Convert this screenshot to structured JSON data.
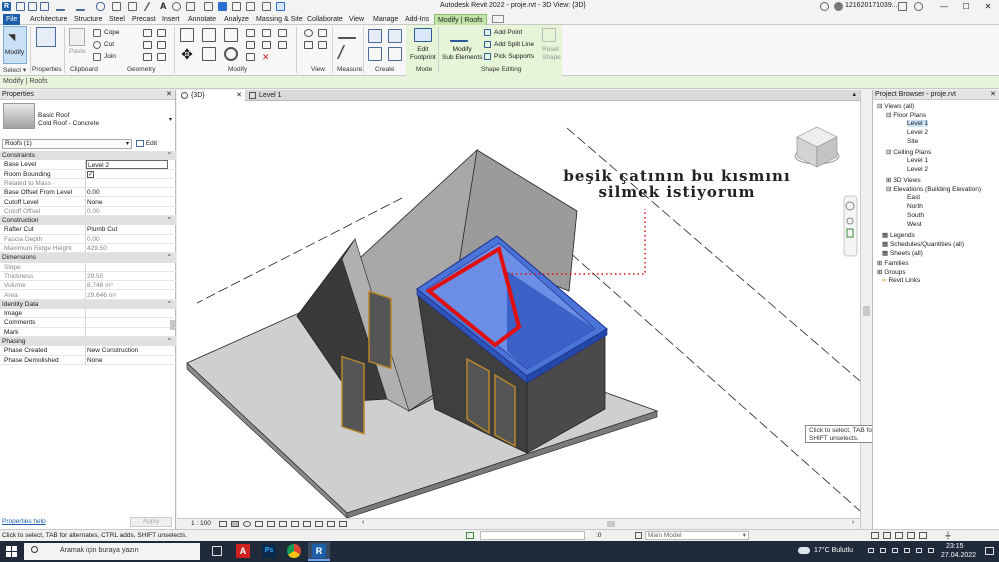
{
  "titlebar": {
    "app_title": "Autodesk Revit 2022 - proje.rvt - 3D View: {3D}",
    "user": "121620171039...",
    "minimize": "—",
    "maximize": "☐",
    "close": "✕"
  },
  "tabs": [
    "File",
    "Architecture",
    "Structure",
    "Steel",
    "Precast",
    "Insert",
    "Annotate",
    "Analyze",
    "Massing & Site",
    "Collaborate",
    "View",
    "Manage",
    "Add-Ins",
    "Modify | Roofs"
  ],
  "ribbon": {
    "modify": "Modify",
    "properties": "Properties",
    "paste": "Paste",
    "cope": "Cope",
    "cut": "Cut",
    "join": "Join",
    "edit_footprint": "Edit\nFootprint",
    "modify_sub": "Modify\nSub Elements",
    "add_point": "Add Point",
    "add_split_line": "Add Split Line",
    "pick_supports": "Pick Supports",
    "reset_shape": "Reset\nShape",
    "panels": {
      "select": "Select ▾",
      "properties": "Properties",
      "clipboard": "Clipboard",
      "geometry": "Geometry",
      "modify": "Modify",
      "view": "View",
      "measure": "Measure",
      "create": "Create",
      "mode": "Mode",
      "shape_editing": "Shape Editing"
    }
  },
  "options_bar": "Modify | Roofs",
  "properties": {
    "header": "Properties",
    "type_family": "Basic Roof",
    "type_name": "Cold Roof - Concrete",
    "selector": "Roofs (1)",
    "edit_type": "Edit Type",
    "groups": {
      "constraints": "Constraints",
      "construction": "Construction",
      "dimensions": "Dimensions",
      "identity": "Identity Data",
      "phasing": "Phasing"
    },
    "rows": {
      "base_level": [
        "Base Level",
        "Level 2"
      ],
      "room_bounding": [
        "Room Bounding",
        ""
      ],
      "related_mass": [
        "Related to Mass",
        ""
      ],
      "base_offset": [
        "Base Offset From Level",
        "0.00"
      ],
      "cutoff_level": [
        "Cutoff Level",
        "None"
      ],
      "cutoff_offset": [
        "Cutoff Offset",
        "0.00"
      ],
      "rafter_cut": [
        "Rafter Cut",
        "Plumb Cut"
      ],
      "fascia_depth": [
        "Fascia Depth",
        "0.00"
      ],
      "max_ridge": [
        "Maximum Ridge Height",
        "429.50"
      ],
      "slope": [
        "Slope",
        ""
      ],
      "thickness": [
        "Thickness",
        "29.50"
      ],
      "volume": [
        "Volume",
        "8.746 m³"
      ],
      "area": [
        "Area",
        "29.646 m²"
      ],
      "image": [
        "Image",
        ""
      ],
      "comments": [
        "Comments",
        ""
      ],
      "mark": [
        "Mark",
        ""
      ],
      "phase_created": [
        "Phase Created",
        "New Construction"
      ],
      "phase_demolished": [
        "Phase Demolished",
        "None"
      ]
    },
    "help_link": "Properties help",
    "apply": "Apply"
  },
  "view_tabs": [
    "{3D}",
    "Level 1"
  ],
  "viewport": {
    "annotation_line1": "beşik çatının bu kısmını",
    "annotation_line2": "silmek istiyorum",
    "scale": "1 : 100"
  },
  "tooltip": "Click to select, TAB for alternates, CTRL adds, SHIFT unselects.",
  "browser": {
    "header": "Project Browser - proje.rvt",
    "items": [
      "Views (all)",
      "Floor Plans",
      "Level 1",
      "Level 2",
      "Site",
      "Ceiling Plans",
      "Level 1",
      "Level 2",
      "3D Views",
      "Elevations (Building Elevation)",
      "East",
      "North",
      "South",
      "West",
      "Legends",
      "Schedules/Quantities (all)",
      "Sheets (all)",
      "Families",
      "Groups",
      "Revit Links"
    ]
  },
  "statusbar": {
    "message": "Click to select, TAB for alternates, CTRL adds, SHIFT unselects.",
    "zero": ":0",
    "model": "Main Model"
  },
  "taskbar": {
    "search": "Aramak için buraya yazın",
    "weather": "17°C  Bulutlu",
    "time": "23:15",
    "date": "27.04.2022"
  },
  "colors": {
    "accent_file": "#1c5ea8",
    "contextual_tab": "#c2e4a8",
    "roof_selected": "#4a74d8",
    "highlight_red": "#e01010"
  }
}
